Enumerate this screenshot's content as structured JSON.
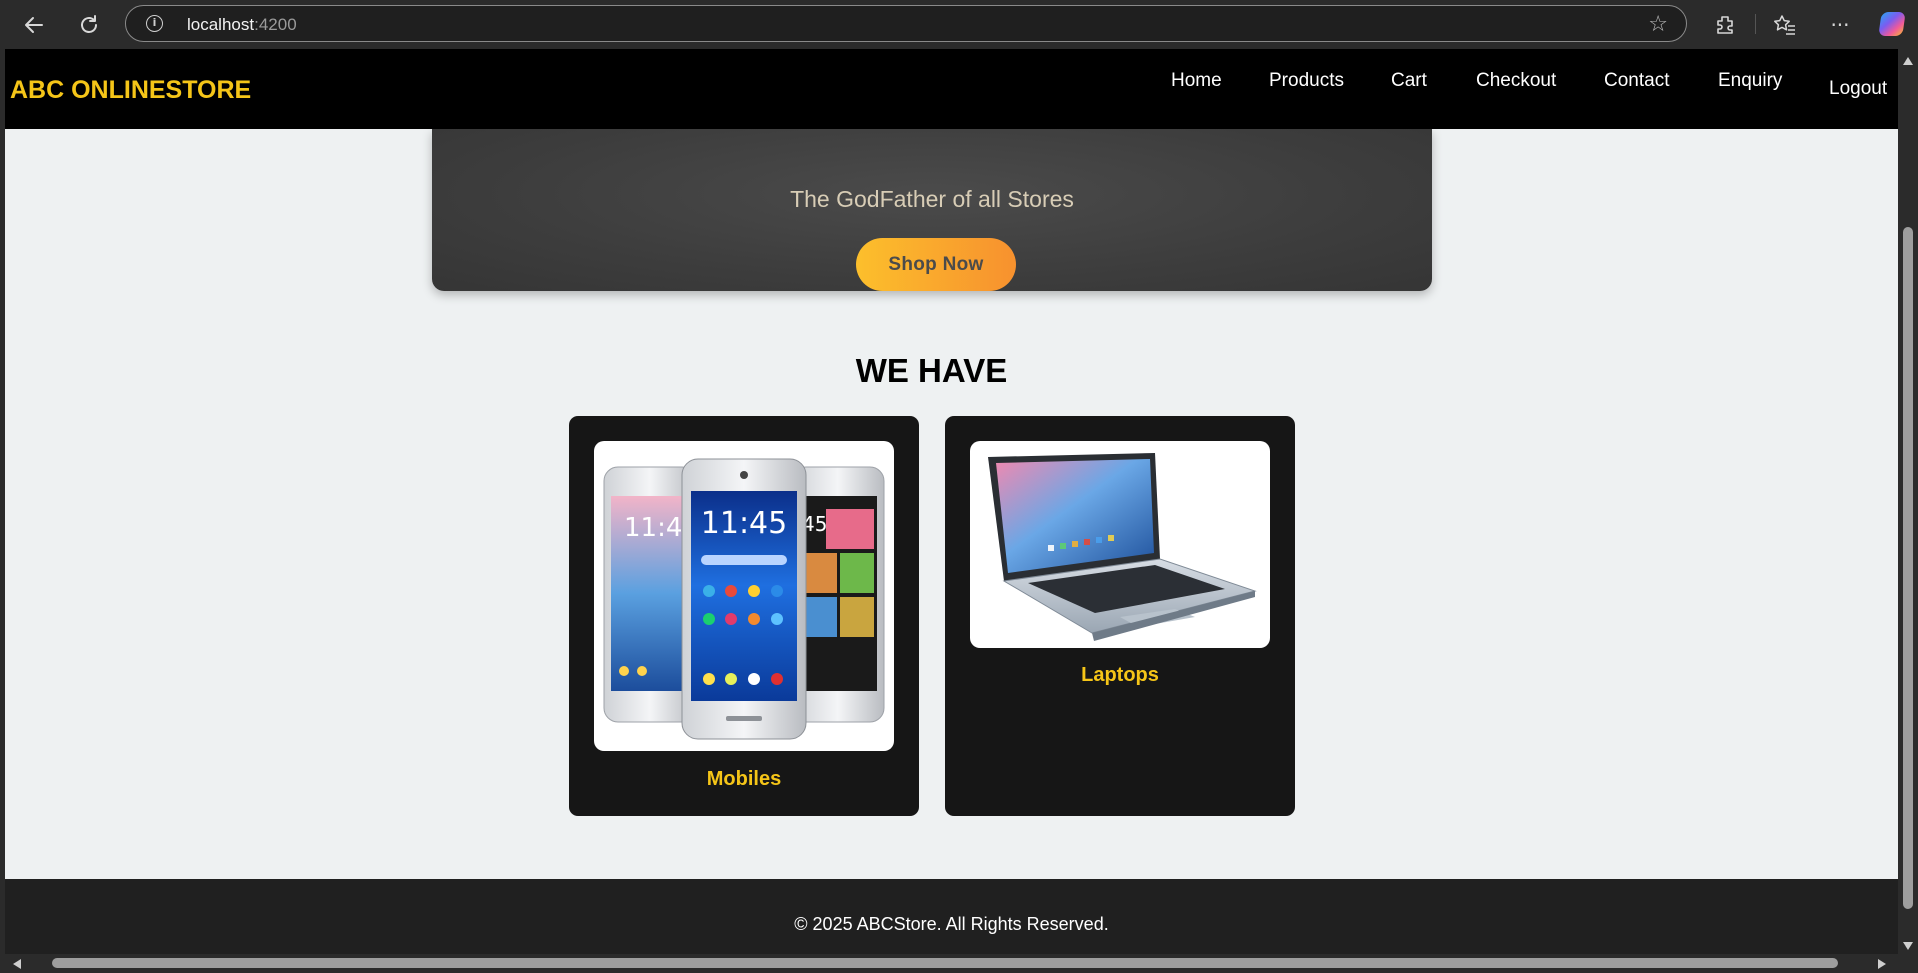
{
  "browser": {
    "url_host": "localhost",
    "url_port": ":4200",
    "icons": [
      "back-arrow-icon",
      "refresh-icon",
      "site-info-icon",
      "favorite-star-icon",
      "extensions-icon",
      "favorites-icon",
      "more-icon",
      "copilot-icon"
    ]
  },
  "header": {
    "brand": "ABC ONLINESTORE",
    "menu": [
      "Home",
      "Products",
      "Cart",
      "Checkout",
      "Contact",
      "Enquiry"
    ],
    "logout": "Logout"
  },
  "hero": {
    "tagline": "The GodFather of all Stores",
    "cta": "Shop Now"
  },
  "categories": {
    "title": "WE HAVE",
    "items": [
      {
        "label": "Mobiles"
      },
      {
        "label": "Laptops"
      }
    ]
  },
  "footer": {
    "copyright": "© 2025 ABCStore. All Rights Reserved."
  },
  "colors": {
    "brand_yellow": "#f5c518",
    "nav_bg": "#000000",
    "card_bg": "#161616",
    "page_bg": "#eef1f2",
    "cta_gradient": [
      "#fcbf2c",
      "#f7912e"
    ]
  }
}
